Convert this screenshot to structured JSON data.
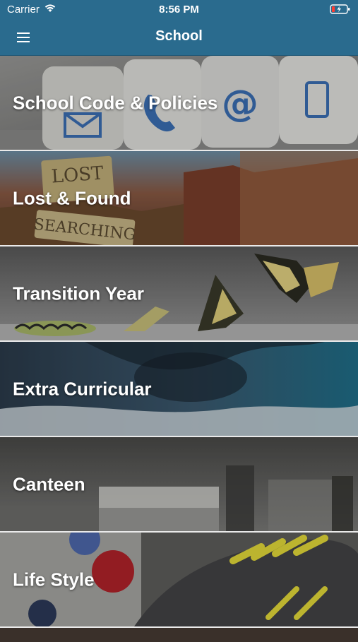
{
  "status_bar": {
    "carrier": "Carrier",
    "time": "8:56 PM"
  },
  "nav": {
    "title": "School"
  },
  "items": [
    {
      "label": "School Code & Policies",
      "image_icon": "contact-icons"
    },
    {
      "label": "Lost & Found",
      "image_icon": "lost-found-sign"
    },
    {
      "label": "Transition Year",
      "image_icon": "butterfly-metamorphosis"
    },
    {
      "label": "Extra Curricular",
      "image_icon": "running-motion"
    },
    {
      "label": "Canteen",
      "image_icon": "cafeteria"
    },
    {
      "label": "Life Style",
      "image_icon": "sneaker-fruit"
    }
  ],
  "colors": {
    "nav_bg": "#2a6b8e",
    "row_divider": "#eaeaea",
    "text": "#ffffff"
  }
}
